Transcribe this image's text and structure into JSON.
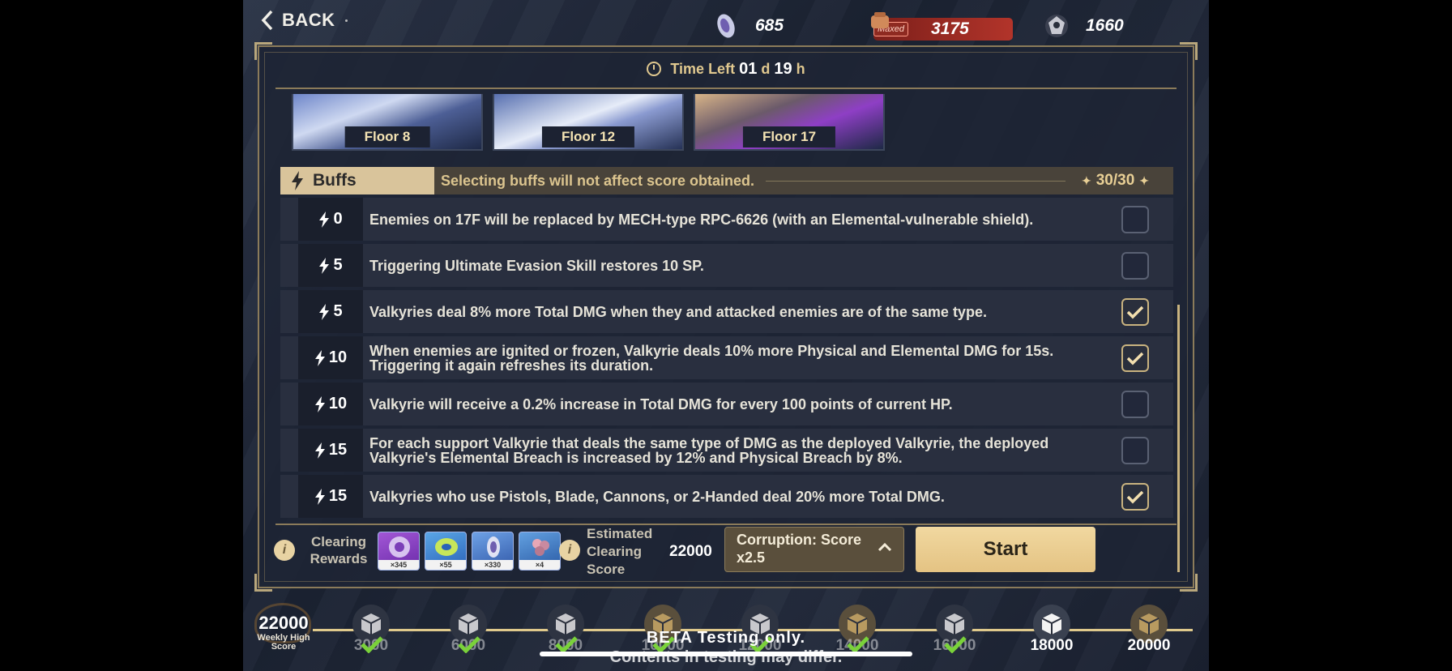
{
  "header": {
    "back_label": "BACK",
    "resources": [
      {
        "icon": "crystal-icon",
        "value": "685"
      },
      {
        "icon": "stamina-icon",
        "badge": "Maxed",
        "value": "3175",
        "color": "#b2342a"
      },
      {
        "icon": "emblem-icon",
        "value": "1660"
      }
    ]
  },
  "timer": {
    "label": "Time Left",
    "days": "01",
    "d": "d",
    "hours": "19",
    "h": "h"
  },
  "floors": [
    {
      "label": "Floor 8"
    },
    {
      "label": "Floor 12"
    },
    {
      "label": "Floor 17"
    }
  ],
  "buffs": {
    "title": "Buffs",
    "note": "Selecting buffs will not affect score obtained.",
    "count": "30/30",
    "items": [
      {
        "cost": "0",
        "text": "Enemies on 17F will be replaced by MECH-type RPC-6626 (with an Elemental-vulnerable shield).",
        "checked": false
      },
      {
        "cost": "5",
        "text": "Triggering Ultimate Evasion Skill restores 10 SP.",
        "checked": false
      },
      {
        "cost": "5",
        "text": "Valkyries deal 8% more Total DMG when they and attacked enemies are of the same type.",
        "checked": true
      },
      {
        "cost": "10",
        "text": "When enemies are ignited or frozen, Valkyrie deals 10% more Physical and Elemental DMG for 15s. Triggering it again refreshes its duration.",
        "checked": true
      },
      {
        "cost": "10",
        "text": "Valkyrie will receive a 0.2% increase in Total DMG for every 100 points of current HP.",
        "checked": false
      },
      {
        "cost": "15",
        "text": "For each support Valkyrie that deals the same type of DMG as the deployed Valkyrie, the deployed Valkyrie's Elemental Breach is increased by 12% and Physical Breach by 8%.",
        "checked": false
      },
      {
        "cost": "15",
        "text": "Valkyries who use Pistols, Blade, Cannons, or 2-Handed deal 20% more Total DMG.",
        "checked": true
      }
    ]
  },
  "footer": {
    "clearing_rewards_label": "Clearing Rewards",
    "rewards": [
      {
        "qty": "×345",
        "icon": "valkyrie-shard-icon"
      },
      {
        "qty": "×55",
        "icon": "material-icon"
      },
      {
        "qty": "×330",
        "icon": "crystal-icon"
      },
      {
        "qty": "×4",
        "icon": "flower-material-icon"
      }
    ],
    "estimated_label": "Estimated Clearing Score",
    "estimated_value": "22000",
    "corruption_label": "Corruption: Score x2.5",
    "start_label": "Start"
  },
  "weekly": {
    "high_score": "22000",
    "high_score_label": "Weekly High Score",
    "nodes": [
      {
        "points": "3000",
        "claimed": true,
        "style": "grey"
      },
      {
        "points": "6000",
        "claimed": true,
        "style": "grey"
      },
      {
        "points": "8000",
        "claimed": true,
        "style": "grey"
      },
      {
        "points": "10000",
        "claimed": true,
        "style": "gold"
      },
      {
        "points": "12000",
        "claimed": true,
        "style": "grey"
      },
      {
        "points": "14000",
        "claimed": true,
        "style": "gold"
      },
      {
        "points": "16000",
        "claimed": true,
        "style": "grey"
      },
      {
        "points": "18000",
        "claimed": false,
        "style": "white"
      },
      {
        "points": "20000",
        "claimed": false,
        "style": "gold"
      }
    ]
  },
  "overlay": {
    "beta_line1": "BETA Testing only.",
    "beta_line2": "Contents in testing may differ."
  }
}
